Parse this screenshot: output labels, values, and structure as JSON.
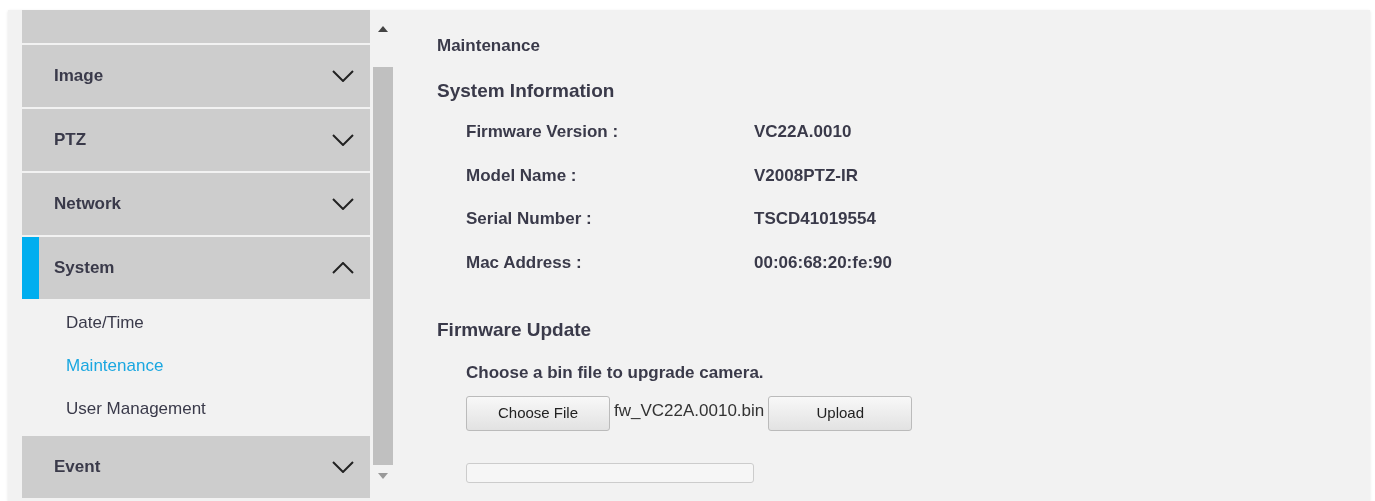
{
  "sidebar": {
    "items": [
      {
        "label": "Image",
        "expanded": false
      },
      {
        "label": "PTZ",
        "expanded": false
      },
      {
        "label": "Network",
        "expanded": false
      },
      {
        "label": "System",
        "expanded": true,
        "children": [
          {
            "label": "Date/Time",
            "selected": false
          },
          {
            "label": "Maintenance",
            "selected": true
          },
          {
            "label": "User Management",
            "selected": false
          }
        ]
      },
      {
        "label": "Event",
        "expanded": false
      }
    ]
  },
  "content": {
    "title": "Maintenance",
    "system_information": {
      "heading": "System Information",
      "rows": [
        {
          "label": "Firmware Version :",
          "value": "VC22A.0010"
        },
        {
          "label": "Model Name :",
          "value": "V2008PTZ-IR"
        },
        {
          "label": "Serial Number :",
          "value": "TSCD41019554"
        },
        {
          "label": "Mac Address :",
          "value": "00:06:68:20:fe:90"
        }
      ]
    },
    "firmware_update": {
      "heading": "Firmware Update",
      "instruction": "Choose a bin file to upgrade camera.",
      "choose_button": "Choose File",
      "file_name": "fw_VC22A.0010.bin",
      "upload_button": "Upload"
    }
  }
}
